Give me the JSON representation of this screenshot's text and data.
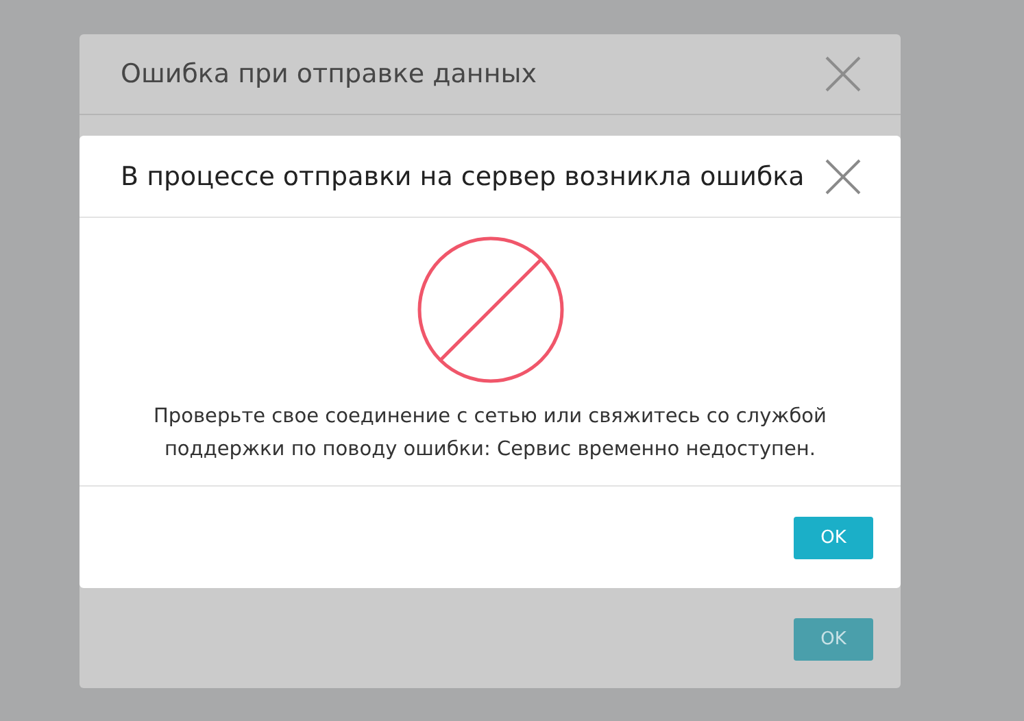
{
  "background_dialog": {
    "title": "Ошибка при отправке данных",
    "button": "OK"
  },
  "dialog": {
    "title": "В процессе отправки на сервер возникла ошибка",
    "message": "Проверьте свое соединение с сетью или свяжитесь со службой поддержки по поводу ошибки: Сервис временно недоступен.",
    "button": "OK"
  }
}
